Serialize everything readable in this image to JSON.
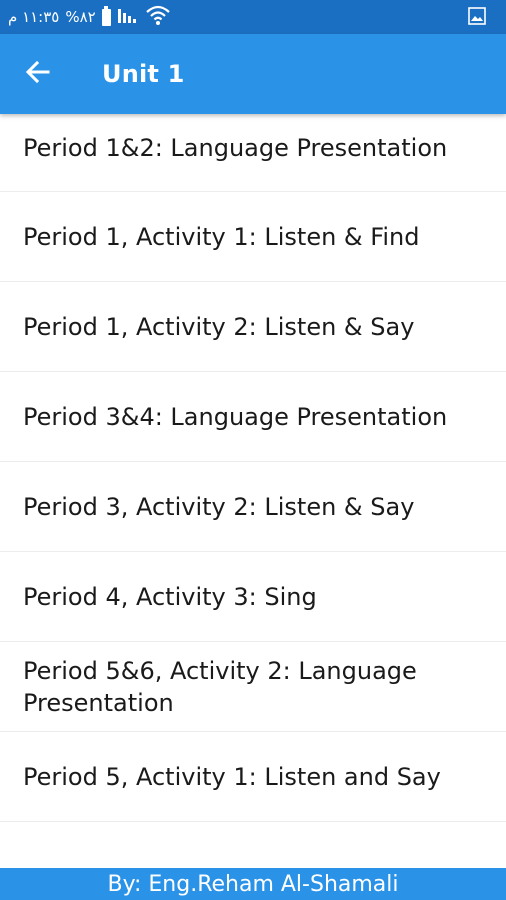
{
  "status_bar": {
    "time": "١١:٣٥ م",
    "battery": "%٨٢",
    "icons": [
      "battery-icon",
      "signal-icon",
      "wifi-icon",
      "image-icon"
    ]
  },
  "header": {
    "title": "Unit 1",
    "back_icon": "arrow-back-icon"
  },
  "list": {
    "items": [
      {
        "label": "Period 1&2: Language Presentation"
      },
      {
        "label": "Period 1, Activity 1: Listen & Find"
      },
      {
        "label": "Period 1, Activity 2: Listen & Say"
      },
      {
        "label": "Period 3&4: Language Presentation"
      },
      {
        "label": "Period 3, Activity 2: Listen & Say"
      },
      {
        "label": "Period 4, Activity 3: Sing"
      },
      {
        "label": "Period 5&6, Activity 2: Language Presentation"
      },
      {
        "label": "Period 5, Activity 1: Listen and Say"
      }
    ]
  },
  "footer": {
    "text": "By: Eng.Reham Al-Shamali"
  },
  "colors": {
    "status_bar": "#1b6fc2",
    "app_bar": "#2a93e8",
    "footer": "#2a93e8",
    "text": "#1a1a1a",
    "divider": "#ececec"
  }
}
